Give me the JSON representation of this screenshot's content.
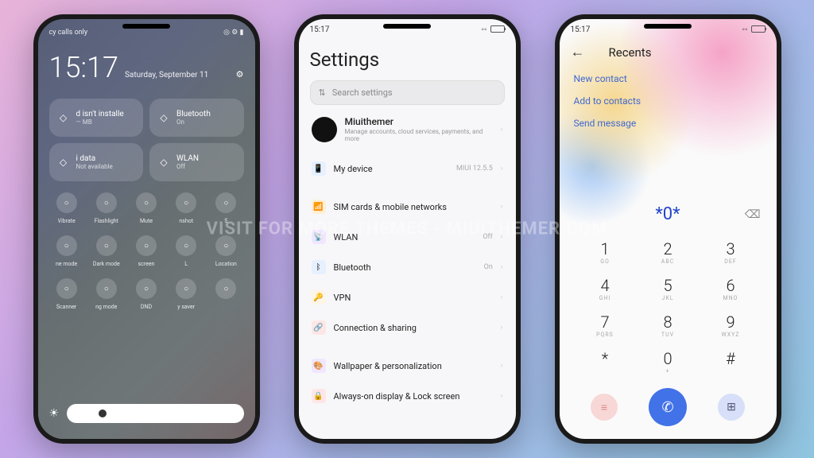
{
  "watermark": "Visit for more themes - miuithemer.com",
  "phone1": {
    "status_left": "cy calls only",
    "time": "15:17",
    "date": "Saturday, September 11",
    "tiles": [
      {
        "title": "d isn't installe",
        "sub": "— MB"
      },
      {
        "title": "Bluetooth",
        "sub": "On"
      },
      {
        "title": "i data",
        "sub": "Not available"
      },
      {
        "title": "WLAN",
        "sub": "Off"
      }
    ],
    "row1": [
      "Vibrate",
      "Flashlight",
      "Mute",
      "nshot",
      "S"
    ],
    "row2": [
      "ne mode",
      "Dark mode",
      "screen",
      "L",
      "Location"
    ],
    "row3": [
      "Scanner",
      "ng mode",
      "DND",
      "y saver",
      ""
    ]
  },
  "phone2": {
    "status_time": "15:17",
    "title": "Settings",
    "search_placeholder": "Search settings",
    "user": {
      "name": "Miuithemer",
      "sub": "Manage accounts, cloud services, payments, and more"
    },
    "items": [
      {
        "label": "My device",
        "value": "MIUI 12.5.5",
        "icon_bg": "#e6f0ff",
        "icon": "📱"
      },
      {
        "gap": true
      },
      {
        "label": "SIM cards & mobile networks",
        "value": "",
        "icon_bg": "#fff0d6",
        "icon": "📶"
      },
      {
        "label": "WLAN",
        "value": "Off",
        "icon_bg": "#f0e6ff",
        "icon": "📡"
      },
      {
        "label": "Bluetooth",
        "value": "On",
        "icon_bg": "#e6f0ff",
        "icon": "ᛒ"
      },
      {
        "label": "VPN",
        "value": "",
        "icon_bg": "#fff5e6",
        "icon": "🔑"
      },
      {
        "label": "Connection & sharing",
        "value": "",
        "icon_bg": "#ffe6e6",
        "icon": "🔗"
      },
      {
        "gap": true
      },
      {
        "label": "Wallpaper & personalization",
        "value": "",
        "icon_bg": "#f0e6ff",
        "icon": "🎨"
      },
      {
        "label": "Always-on display & Lock screen",
        "value": "",
        "icon_bg": "#ffe6e6",
        "icon": "🔒"
      }
    ]
  },
  "phone3": {
    "status_time": "15:17",
    "header_title": "Recents",
    "actions": [
      "New contact",
      "Add to contacts",
      "Send message"
    ],
    "number": "*0*",
    "keys": [
      {
        "n": "1",
        "s": "GO"
      },
      {
        "n": "2",
        "s": "ABC"
      },
      {
        "n": "3",
        "s": "DEF"
      },
      {
        "n": "4",
        "s": "GHI"
      },
      {
        "n": "5",
        "s": "JKL"
      },
      {
        "n": "6",
        "s": "MNO"
      },
      {
        "n": "7",
        "s": "PQRS"
      },
      {
        "n": "8",
        "s": "TUV"
      },
      {
        "n": "9",
        "s": "WXYZ"
      },
      {
        "n": "*",
        "s": ""
      },
      {
        "n": "0",
        "s": "+"
      },
      {
        "n": "#",
        "s": ""
      }
    ]
  }
}
